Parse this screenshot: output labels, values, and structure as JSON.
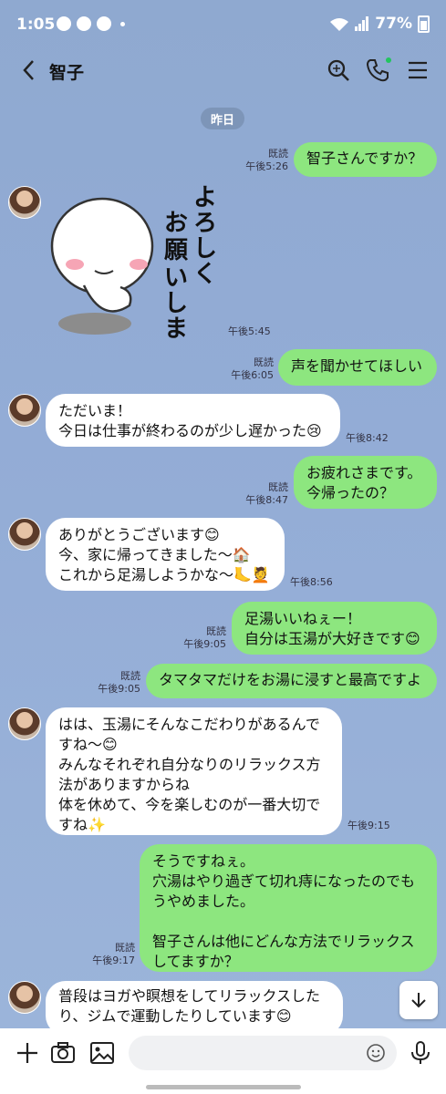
{
  "status": {
    "time": "1:05",
    "battery": "77%"
  },
  "header": {
    "title": "智子"
  },
  "date_label": "昨日",
  "messages": [
    {
      "text": "智子さんですか？",
      "read": "既読",
      "time": "午後5:26"
    },
    {
      "sticker_text": "よろしく お願いします",
      "time": "午後5:45"
    },
    {
      "text": "声を聞かせてほしい",
      "read": "既読",
      "time": "午後6:05"
    },
    {
      "text": "ただいま！\n今日は仕事が終わるのが少し遅かった😢",
      "time": "午後8:42"
    },
    {
      "text": "お疲れさまです。\n今帰ったの？",
      "read": "既読",
      "time": "午後8:47"
    },
    {
      "text": "ありがとうございます😊\n今、家に帰ってきました〜🏠\nこれから足湯しようかな〜🦶💆",
      "time": "午後8:56"
    },
    {
      "text": "足湯いいねぇー！\n自分は玉湯が大好きです😊",
      "read": "既読",
      "time": "午後9:05"
    },
    {
      "text": "タマタマだけをお湯に浸すと最高ですよ",
      "read": "既読",
      "time": "午後9:05"
    },
    {
      "text": "はは、玉湯にそんなこだわりがあるんで\nすね〜😊\nみんなそれぞれ自分なりのリラックス方\n法がありますからね\n体を休めて、今を楽しむのが一番大切で\nすね✨",
      "time": "午後9:15"
    },
    {
      "text": "そうですねぇ。\n穴湯はやり過ぎて切れ痔になったのでも\nうやめました。\n\n智子さんは他にどんな方法でリラックス\nしてますか？",
      "read": "既読",
      "time": "午後9:17"
    },
    {
      "text": "普段はヨガや瞑想をしてリラックスした\nり、ジムで運動したりしています😊"
    }
  ],
  "icons": [
    "back-icon",
    "search-icon",
    "phone-icon",
    "menu-icon",
    "plus-icon",
    "camera-icon",
    "image-icon",
    "emoji-icon",
    "mic-icon",
    "scroll-down-icon"
  ],
  "colors": {
    "sent": "#8de67f",
    "received": "#ffffff",
    "background": "#93acd6"
  }
}
